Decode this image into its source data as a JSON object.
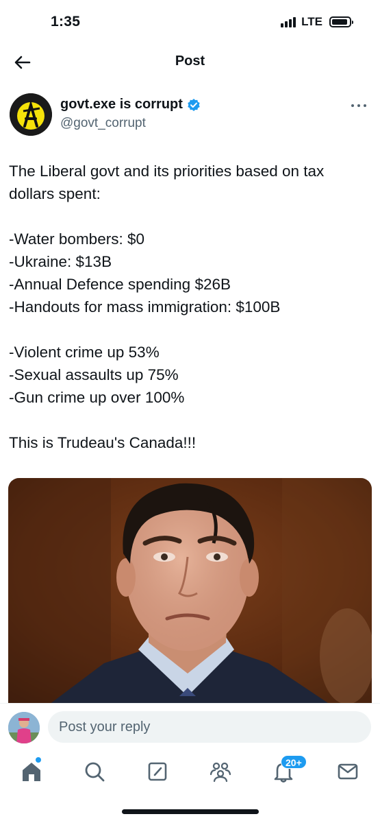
{
  "status_bar": {
    "time": "1:35",
    "network": "LTE"
  },
  "header": {
    "title": "Post",
    "back_icon": "arrow-left-icon"
  },
  "post": {
    "author": {
      "name": "govt.exe is corrupt",
      "handle": "@govt_corrupt",
      "verified": true,
      "verified_color": "#1d9bf0"
    },
    "text": {
      "intro": "The Liberal govt and its priorities based on tax dollars spent:",
      "spending": [
        "-Water bombers: $0",
        "-Ukraine: $13B",
        "-Annual Defence spending $26B",
        "-Handouts for mass immigration: $100B"
      ],
      "crime": [
        "-Violent crime up 53%",
        "-Sexual assaults up 75%",
        "-Gun crime up over 100%"
      ],
      "closing": "This is Trudeau's Canada!!!"
    },
    "media": {
      "type": "photo"
    }
  },
  "reply": {
    "placeholder": "Post your reply"
  },
  "nav": {
    "items": [
      "home-icon",
      "search-icon",
      "compose-icon",
      "communities-icon",
      "notifications-icon",
      "messages-icon"
    ],
    "notifications_badge": "20+",
    "accent": "#1d9bf0"
  }
}
